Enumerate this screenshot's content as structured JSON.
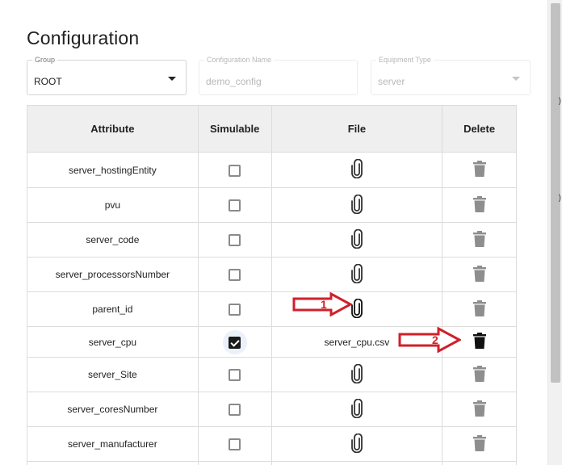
{
  "page": {
    "title": "Configuration"
  },
  "fields": {
    "group": {
      "label": "Group",
      "value": "ROOT"
    },
    "config_name": {
      "label": "Configuration Name",
      "value": "demo_config"
    },
    "equipment_type": {
      "label": "Equipment Type",
      "value": "server"
    }
  },
  "table": {
    "headers": [
      "Attribute",
      "Simulable",
      "File",
      "Delete"
    ],
    "rows": [
      {
        "attribute": "server_hostingEntity",
        "simulable": false,
        "file": ""
      },
      {
        "attribute": "pvu",
        "simulable": false,
        "file": ""
      },
      {
        "attribute": "server_code",
        "simulable": false,
        "file": ""
      },
      {
        "attribute": "server_processorsNumber",
        "simulable": false,
        "file": ""
      },
      {
        "attribute": "parent_id",
        "simulable": false,
        "file": ""
      },
      {
        "attribute": "server_cpu",
        "simulable": true,
        "file": "server_cpu.csv"
      },
      {
        "attribute": "server_Site",
        "simulable": false,
        "file": ""
      },
      {
        "attribute": "server_coresNumber",
        "simulable": false,
        "file": ""
      },
      {
        "attribute": "server_manufacturer",
        "simulable": false,
        "file": ""
      }
    ]
  },
  "annotations": {
    "arrow1": "1",
    "arrow2": "2",
    "color": "#d0202a"
  },
  "icons": {
    "file": "paperclip-icon",
    "delete": "trash-icon",
    "dropdown": "caret-down-icon"
  }
}
